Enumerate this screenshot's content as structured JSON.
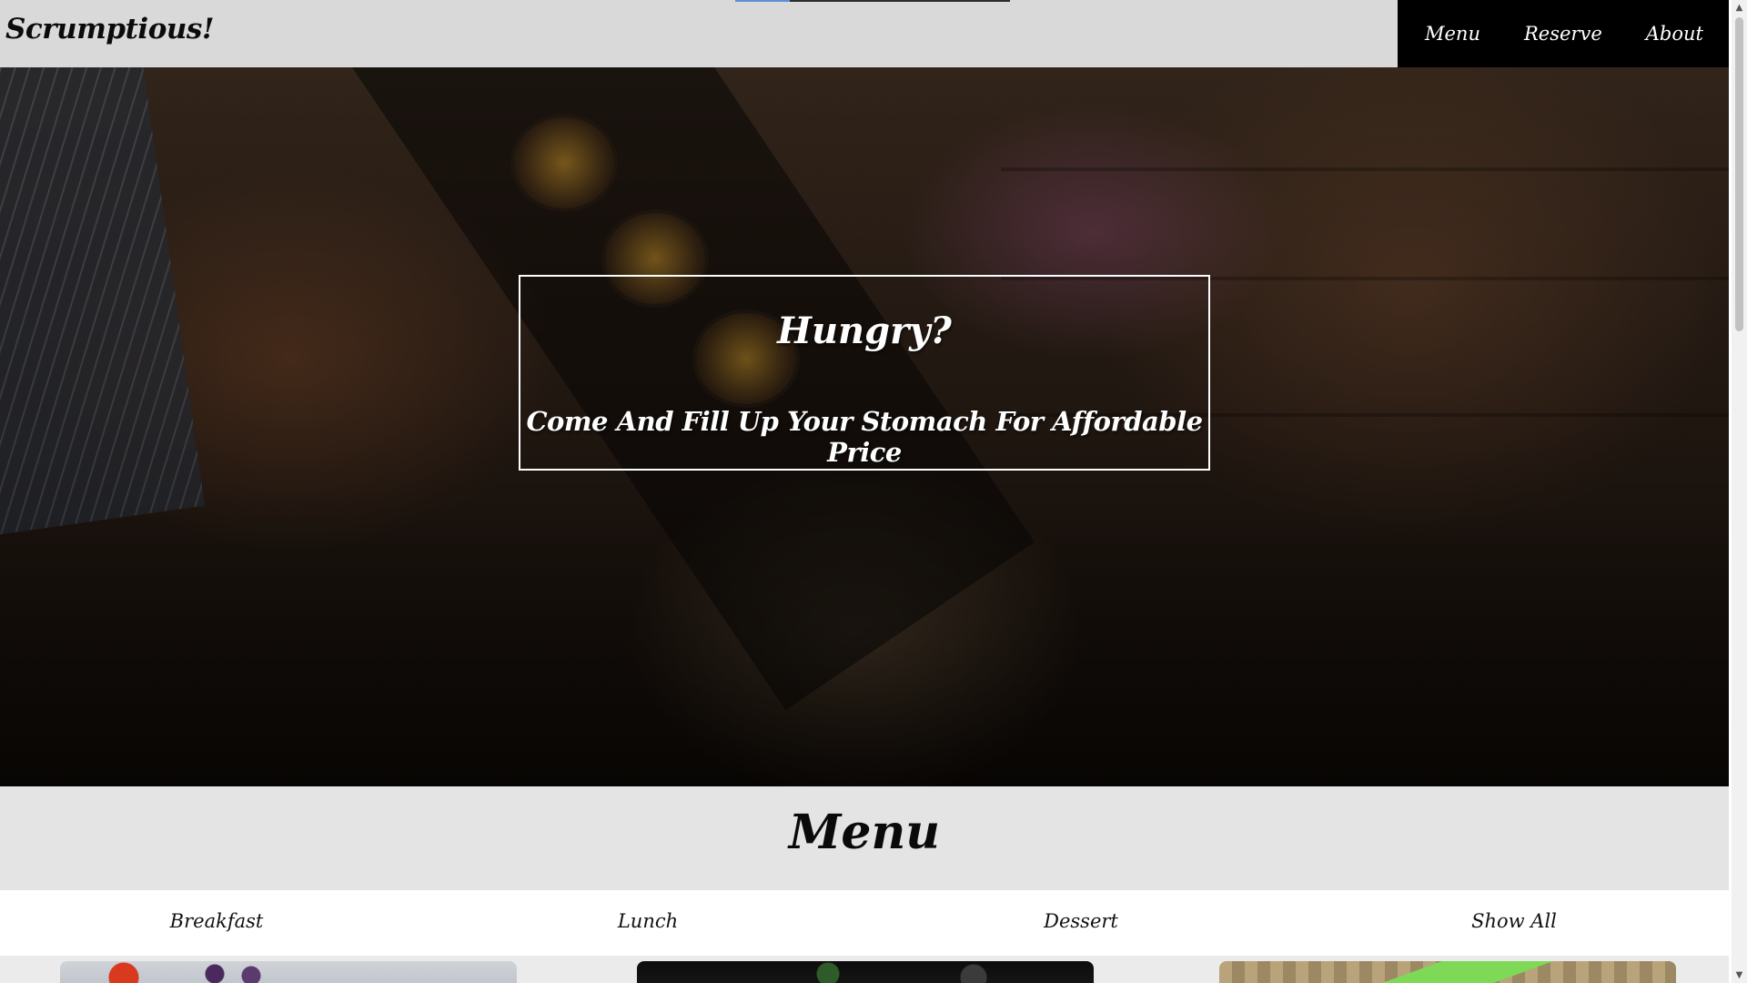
{
  "header": {
    "brand": "Scrumptious!",
    "nav": {
      "menu": "Menu",
      "reserve": "Reserve",
      "about": "About"
    },
    "scroll_progress": 0.2
  },
  "hero": {
    "title": "Hungry?",
    "subtitle": "Come And Fill Up Your Stomach For Affordable Price"
  },
  "menu_section": {
    "heading": "Menu",
    "tabs": {
      "breakfast": "Breakfast",
      "lunch": "Lunch",
      "dessert": "Dessert",
      "show_all": "Show All"
    }
  },
  "scrollbar": {
    "up_arrow": "▲",
    "down_arrow": "▼"
  },
  "colors": {
    "header_bg": "#d9d9d9",
    "nav_bg": "#000000",
    "menu_band_bg": "#e4e4e4",
    "text_dark": "#0a0a0a",
    "text_light": "#ffffff"
  }
}
